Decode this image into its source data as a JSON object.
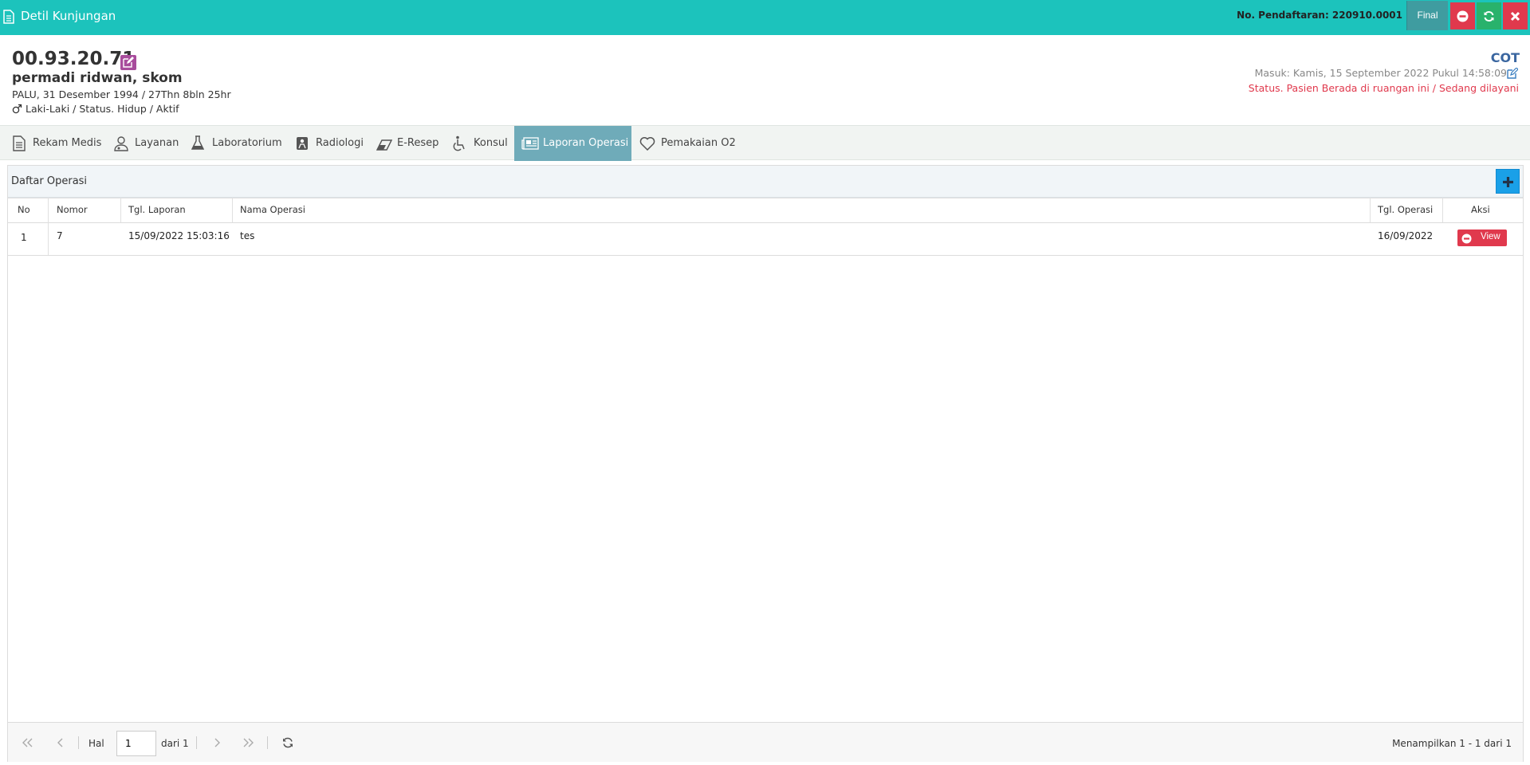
{
  "titlebar": {
    "title": "Detil Kunjungan",
    "registration": "No. Pendaftaran: 220910.0001",
    "final_label": "Final",
    "colors": {
      "bar": "#1cc3bc",
      "final": "#3f9ca0",
      "danger": "#e0394d",
      "success": "#29b26c"
    }
  },
  "patient": {
    "rm_number": "00.93.20.71",
    "name": "permadi ridwan, skom",
    "birth": "PALU, 31 Desember 1994 / 27Thn 8bln 25hr",
    "status": "Laki-Laki / Status. Hidup / Aktif"
  },
  "visit": {
    "unit": "COT",
    "masuk": "Masuk: Kamis, 15 September 2022 Pukul 14:58:09",
    "status": "Status. Pasien Berada di ruangan ini / Sedang dilayani"
  },
  "tabs": [
    {
      "label": "Rekam Medis",
      "icon": "document-icon"
    },
    {
      "label": "Layanan",
      "icon": "doctor-icon"
    },
    {
      "label": "Laboratorium",
      "icon": "flask-icon"
    },
    {
      "label": "Radiologi",
      "icon": "xray-icon"
    },
    {
      "label": "E-Resep",
      "icon": "eraser-icon"
    },
    {
      "label": "Konsul",
      "icon": "wheelchair-icon"
    },
    {
      "label": "Laporan Operasi",
      "icon": "newspaper-icon",
      "active": true
    },
    {
      "label": "Pemakaian O2",
      "icon": "heart-icon"
    }
  ],
  "panel": {
    "title": "Daftar Operasi",
    "columns": {
      "no": "No",
      "nomor": "Nomor",
      "tgl_laporan": "Tgl. Laporan",
      "nama_operasi": "Nama Operasi",
      "tgl_operasi": "Tgl. Operasi",
      "aksi": "Aksi"
    },
    "rows": [
      {
        "no": "1",
        "nomor": "7",
        "tgl_laporan": "15/09/2022 15:03:16",
        "nama_operasi": "tes",
        "tgl_operasi": "16/09/2022",
        "aksi": "View"
      }
    ]
  },
  "pager": {
    "hal_label": "Hal",
    "page_value": "1",
    "dari_label": "dari 1",
    "summary": "Menampilkan 1 - 1 dari 1"
  }
}
